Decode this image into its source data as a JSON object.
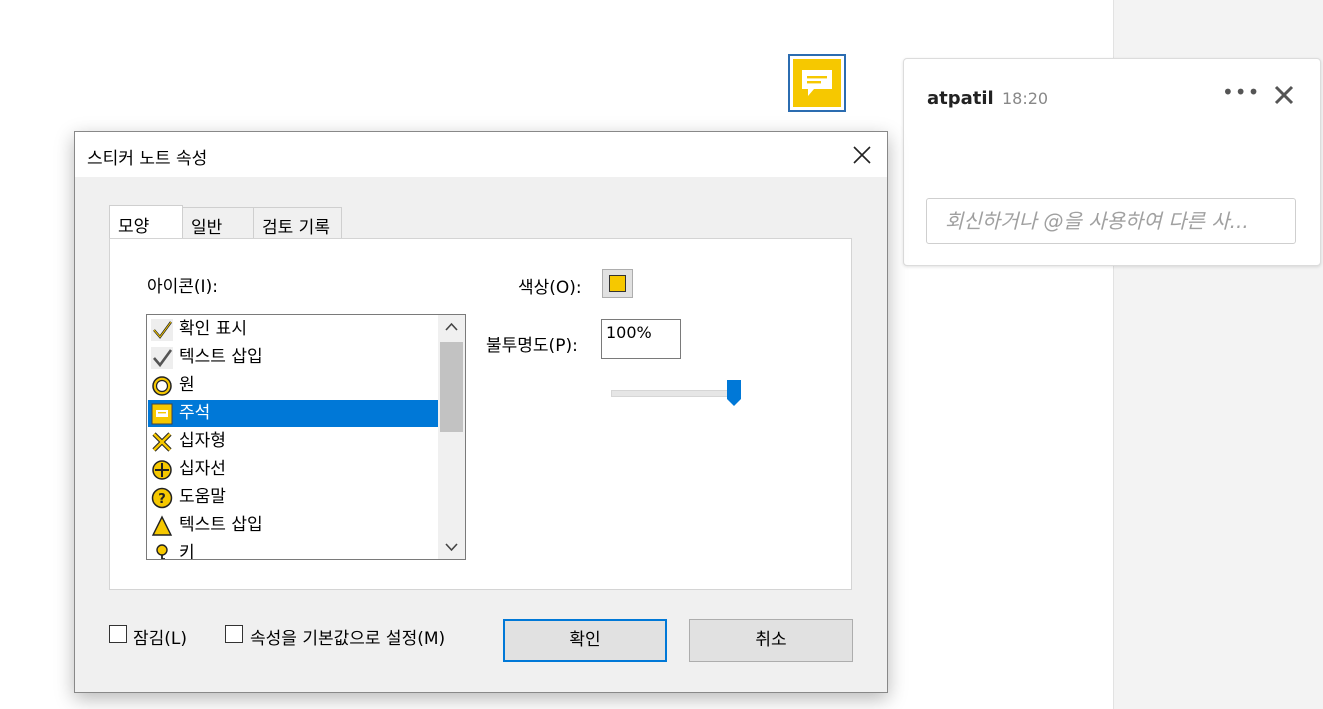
{
  "comment": {
    "author": "atpatil",
    "time": "18:20",
    "more_label": "•••",
    "reply_placeholder": "회신하거나 @을 사용하여 다른 사..."
  },
  "dialog": {
    "title": "스티커 노트 속성",
    "tabs": [
      {
        "label": "모양"
      },
      {
        "label": "일반"
      },
      {
        "label": "검토 기록"
      }
    ],
    "icon_label": "아이콘(I):",
    "icon_items": [
      {
        "label": "확인 표시",
        "icon": "checkmark-icon"
      },
      {
        "label": "텍스트 삽입",
        "icon": "check-icon"
      },
      {
        "label": "원",
        "icon": "circle-icon"
      },
      {
        "label": "주석",
        "icon": "comment-icon",
        "selected": true
      },
      {
        "label": "십자형",
        "icon": "cross-icon"
      },
      {
        "label": "십자선",
        "icon": "crosshair-icon"
      },
      {
        "label": "도움말",
        "icon": "help-icon"
      },
      {
        "label": "텍스트 삽입",
        "icon": "triangle-insert-icon"
      },
      {
        "label": "키",
        "icon": "key-icon"
      }
    ],
    "color_label": "색상(O):",
    "color_value": "#f6c800",
    "opacity_label": "불투명도(P):",
    "opacity_value": "100%",
    "opacity_fraction": 1.0,
    "lock_label": "잠김(L)",
    "default_label": "속성을 기본값으로 설정(M)",
    "ok_label": "확인",
    "cancel_label": "취소"
  },
  "colors": {
    "accent": "#0078d7",
    "note_yellow": "#f6c800"
  }
}
